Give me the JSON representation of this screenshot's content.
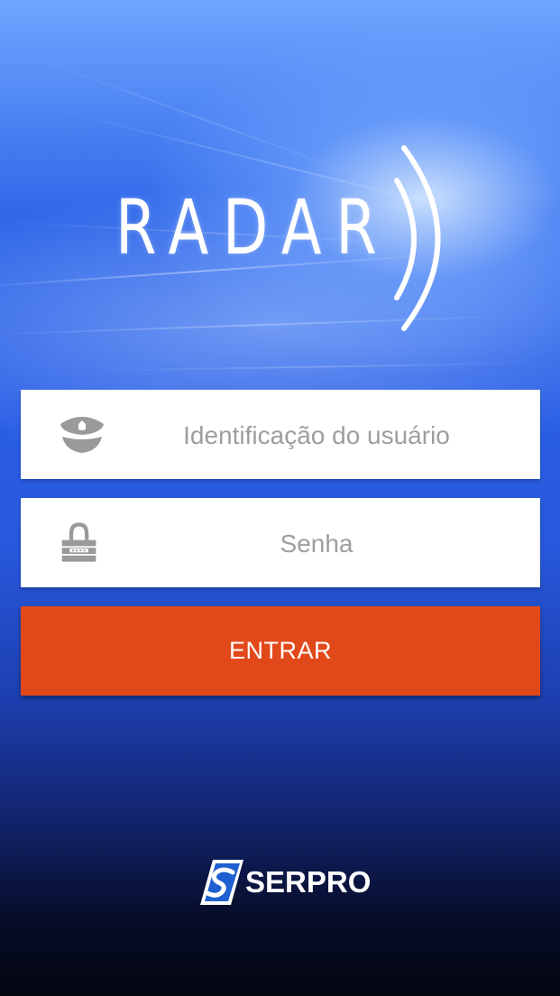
{
  "app": {
    "logo_text": "RADAR",
    "footer_brand": "SERPRO"
  },
  "login": {
    "username": {
      "placeholder": "Identificação do usuário",
      "icon": "police-cap-icon"
    },
    "password": {
      "placeholder": "Senha",
      "icon": "padlock-icon"
    },
    "submit_label": "ENTRAR"
  },
  "colors": {
    "accent": "#e2491a",
    "field_bg": "#ffffff",
    "placeholder_text": "#9e9e9e",
    "icon_gray": "#9a9a9a"
  }
}
